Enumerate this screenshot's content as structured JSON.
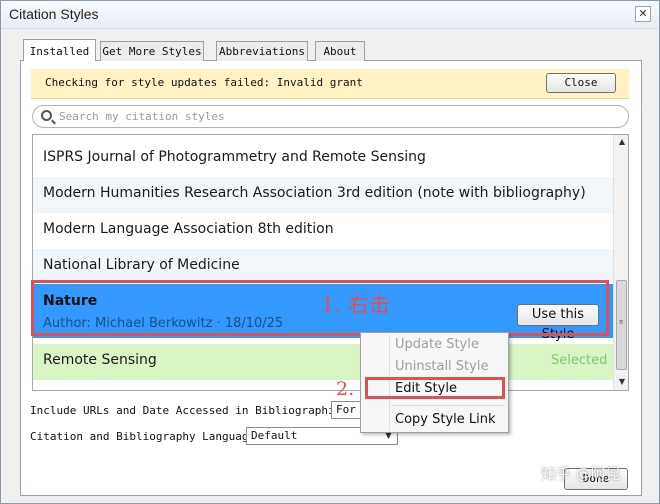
{
  "window": {
    "title": "Citation Styles",
    "close_glyph": "✕"
  },
  "tabs": [
    {
      "label": "Installed"
    },
    {
      "label": "Get More Styles"
    },
    {
      "label": "Abbreviations"
    },
    {
      "label": "About"
    }
  ],
  "notice": {
    "message": "Checking for style updates failed: Invalid grant",
    "close_label": "Close"
  },
  "search": {
    "placeholder": "Search my citation styles",
    "value": ""
  },
  "styles": [
    {
      "name": "ISPRS Journal of Photogrammetry and Remote Sensing"
    },
    {
      "name": "Modern Humanities Research Association 3rd edition (note with bibliography)"
    },
    {
      "name": "Modern Language Association 8th edition"
    },
    {
      "name": "National Library of Medicine"
    },
    {
      "name": "Nature",
      "author": "Author: Michael Berkowitz · 18/10/25",
      "use_label": "Use this Style"
    },
    {
      "name": "Remote Sensing",
      "status": "Selected"
    }
  ],
  "options": {
    "urls_label": "Include URLs and Date Accessed in Bibliographies:",
    "urls_value": "For a",
    "language_label": "Citation and Bibliography Language:",
    "language_value": "Default"
  },
  "context_menu": {
    "items": [
      {
        "label": "Update Style",
        "enabled": false
      },
      {
        "label": "Uninstall Style",
        "enabled": false
      },
      {
        "label": "Edit Style",
        "enabled": true
      },
      {
        "label": "Copy Style Link",
        "enabled": true
      }
    ]
  },
  "annotations": {
    "step1": "1. 右击",
    "step2": "2."
  },
  "footer": {
    "done_label": "Done"
  },
  "watermark": "知乎 @阿昆",
  "colors": {
    "selection": "#3399ff",
    "installed": "#d9f5c4",
    "annotation": "#e05050",
    "notice": "#fff3c4"
  }
}
